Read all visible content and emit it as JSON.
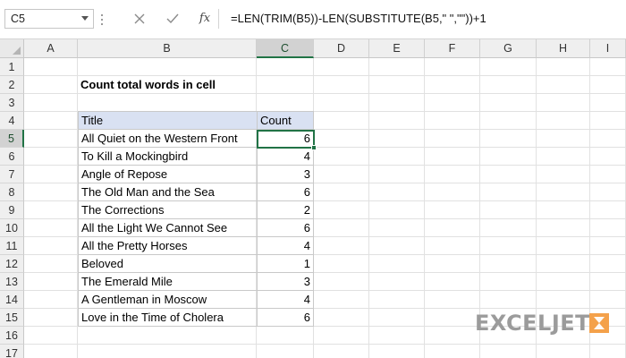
{
  "formula_bar": {
    "name_box": "C5",
    "cancel_icon": "close-icon",
    "enter_icon": "check-icon",
    "function_label": "fx",
    "formula": "=LEN(TRIM(B5))-LEN(SUBSTITUTE(B5,\" \",\"\"))+1"
  },
  "grid": {
    "columns": [
      "A",
      "B",
      "C",
      "D",
      "E",
      "F",
      "G",
      "H",
      "I"
    ],
    "rows": [
      "1",
      "2",
      "3",
      "4",
      "5",
      "6",
      "7",
      "8",
      "9",
      "10",
      "11",
      "12",
      "13",
      "14",
      "15",
      "16",
      "17"
    ],
    "selected_column": "C",
    "selected_row": "5",
    "selection_color": "#217346",
    "header_fill": "#d9e1f2"
  },
  "sheet": {
    "heading": "Count total words in cell",
    "table": {
      "headers": [
        "Title",
        "Count"
      ],
      "rows": [
        {
          "title": "All Quiet on the Western Front",
          "count": "6"
        },
        {
          "title": "To Kill a Mockingbird",
          "count": "4"
        },
        {
          "title": "Angle of Repose",
          "count": "3"
        },
        {
          "title": "The Old Man and the Sea",
          "count": "6"
        },
        {
          "title": "The Corrections",
          "count": "2"
        },
        {
          "title": "All the Light We Cannot See",
          "count": "6"
        },
        {
          "title": "All the Pretty Horses",
          "count": "4"
        },
        {
          "title": "Beloved",
          "count": "1"
        },
        {
          "title": "The Emerald Mile",
          "count": "3"
        },
        {
          "title": "A Gentleman in Moscow",
          "count": "4"
        },
        {
          "title": "Love in the Time of Cholera",
          "count": "6"
        }
      ]
    }
  },
  "watermark": {
    "text": "EXCELJET",
    "text_color": "#9b9b9b",
    "mark_color": "#f4a14a"
  }
}
